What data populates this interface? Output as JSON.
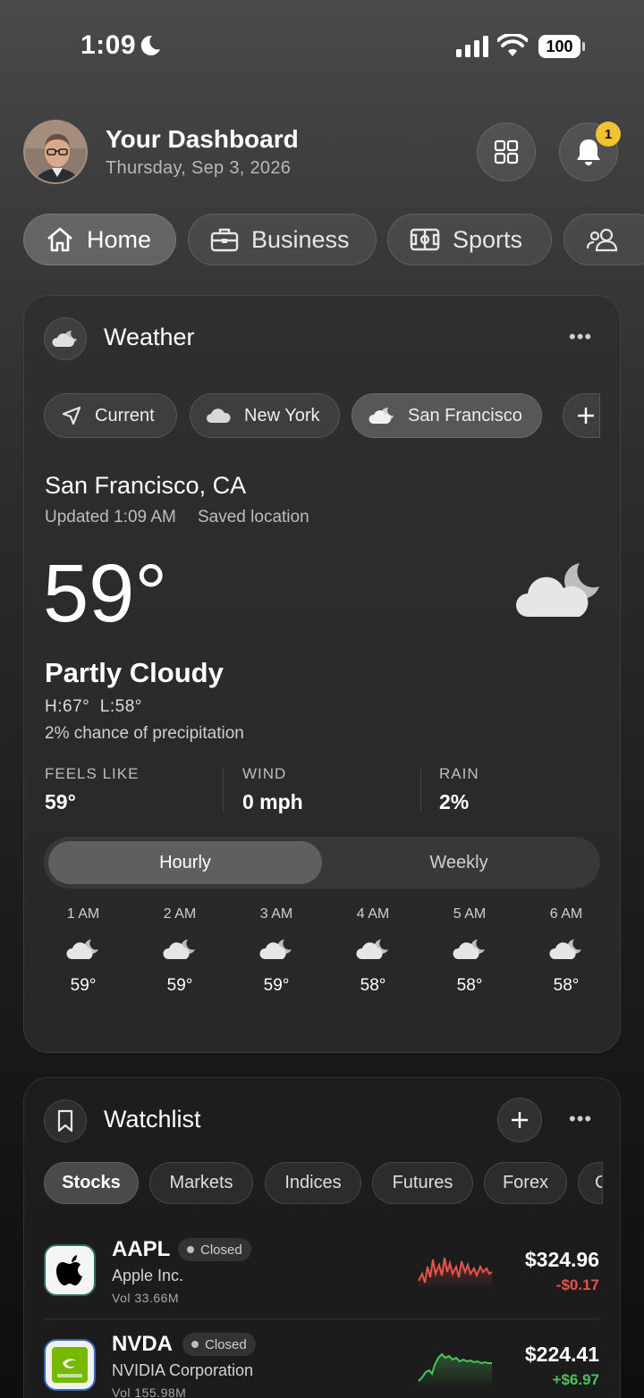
{
  "status_bar": {
    "time": "1:09",
    "battery": "100"
  },
  "header": {
    "title": "Your Dashboard",
    "date": "Thursday, Sep 3, 2026",
    "notification_count": "1"
  },
  "tabs": [
    {
      "label": "Home",
      "icon": "home-icon"
    },
    {
      "label": "Business",
      "icon": "briefcase-icon"
    },
    {
      "label": "Sports",
      "icon": "field-icon"
    },
    {
      "label": "",
      "icon": "people-icon"
    }
  ],
  "weather": {
    "title": "Weather",
    "locations": [
      "Current",
      "New York",
      "San Francisco"
    ],
    "selected_location": "San Francisco",
    "location_name": "San Francisco, CA",
    "updated": "Updated 1:09 AM",
    "saved": "Saved location",
    "temperature": "59°",
    "condition": "Partly Cloudy",
    "high_low": "H:67°  L:58°",
    "precipitation": "2% chance of precipitation",
    "stats": [
      {
        "label": "FEELS LIKE",
        "value": "59°"
      },
      {
        "label": "WIND",
        "value": "0 mph"
      },
      {
        "label": "RAIN",
        "value": "2%"
      }
    ],
    "segments": {
      "hourly": "Hourly",
      "weekly": "Weekly",
      "selected": "Hourly"
    },
    "hourly": [
      {
        "time": "1 AM",
        "temp": "59°",
        "icon": "partly-cloudy-night-icon"
      },
      {
        "time": "2 AM",
        "temp": "59°",
        "icon": "partly-cloudy-night-icon"
      },
      {
        "time": "3 AM",
        "temp": "59°",
        "icon": "partly-cloudy-night-icon"
      },
      {
        "time": "4 AM",
        "temp": "58°",
        "icon": "partly-cloudy-night-icon"
      },
      {
        "time": "5 AM",
        "temp": "58°",
        "icon": "partly-cloudy-night-icon"
      },
      {
        "time": "6 AM",
        "temp": "58°",
        "icon": "partly-cloudy-night-icon"
      }
    ]
  },
  "watchlist": {
    "title": "Watchlist",
    "tabs": [
      "Stocks",
      "Markets",
      "Indices",
      "Futures",
      "Forex",
      "C"
    ],
    "selected_tab": "Stocks",
    "stocks": [
      {
        "symbol": "AAPL",
        "status": "Closed",
        "name": "Apple Inc.",
        "volume": "Vol 33.66M",
        "price": "$324.96",
        "change": "-$0.17",
        "change_color": "#e5534b"
      },
      {
        "symbol": "NVDA",
        "status": "Closed",
        "name": "NVIDIA Corporation",
        "volume": "Vol 155.98M",
        "price": "$224.41",
        "change": "+$6.97",
        "change_color": "#4cc35a"
      }
    ]
  }
}
